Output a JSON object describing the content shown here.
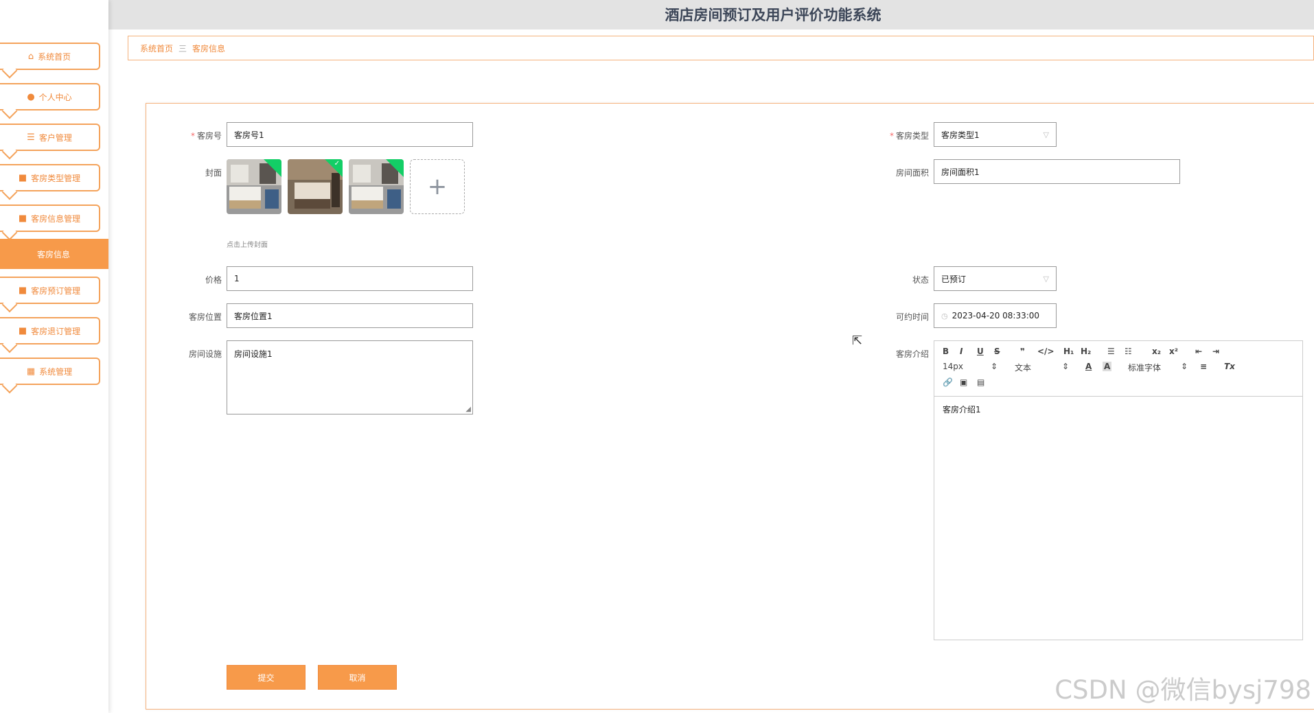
{
  "app": {
    "title": "酒店房间预订及用户评价功能系统"
  },
  "sidebar": {
    "items": [
      {
        "label": "系统首页",
        "icon": "⌂"
      },
      {
        "label": "个人中心",
        "icon": "●"
      },
      {
        "label": "客户管理",
        "icon": "☰"
      },
      {
        "label": "客房类型管理",
        "icon": "■"
      },
      {
        "label": "客房信息管理",
        "icon": "■"
      },
      {
        "label": "客房信息",
        "icon": ""
      },
      {
        "label": "客房预订管理",
        "icon": "■"
      },
      {
        "label": "客房退订管理",
        "icon": "■"
      },
      {
        "label": "系统管理",
        "icon": "▦"
      }
    ]
  },
  "breadcrumb": {
    "home": "系统首页",
    "separator": "三",
    "current": "客房信息"
  },
  "form": {
    "room_no": {
      "label": "客房号",
      "value": "客房号1"
    },
    "room_type": {
      "label": "客房类型",
      "value": "客房类型1"
    },
    "cover": {
      "label": "封面",
      "hint": "点击上传封面",
      "add_icon": "+"
    },
    "area": {
      "label": "房间面积",
      "value": "房间面积1"
    },
    "price": {
      "label": "价格",
      "value": "1"
    },
    "status": {
      "label": "状态",
      "value": "已预订"
    },
    "location": {
      "label": "客房位置",
      "value": "客房位置1"
    },
    "available_time": {
      "label": "可约时间",
      "value": "2023-04-20 08:33:00"
    },
    "facilities": {
      "label": "房间设施",
      "value": "房间设施1"
    },
    "intro": {
      "label": "客房介绍",
      "value": "客房介绍1",
      "font_size": "14px",
      "header_select": "文本",
      "font_select": "标准字体"
    },
    "submit": "提交",
    "cancel": "取消"
  },
  "watermark": "CSDN @微信bysj798",
  "colors": {
    "accent": "#f79a4a",
    "accent_text": "#f08a3c",
    "header_bg": "#e3e3e3"
  }
}
